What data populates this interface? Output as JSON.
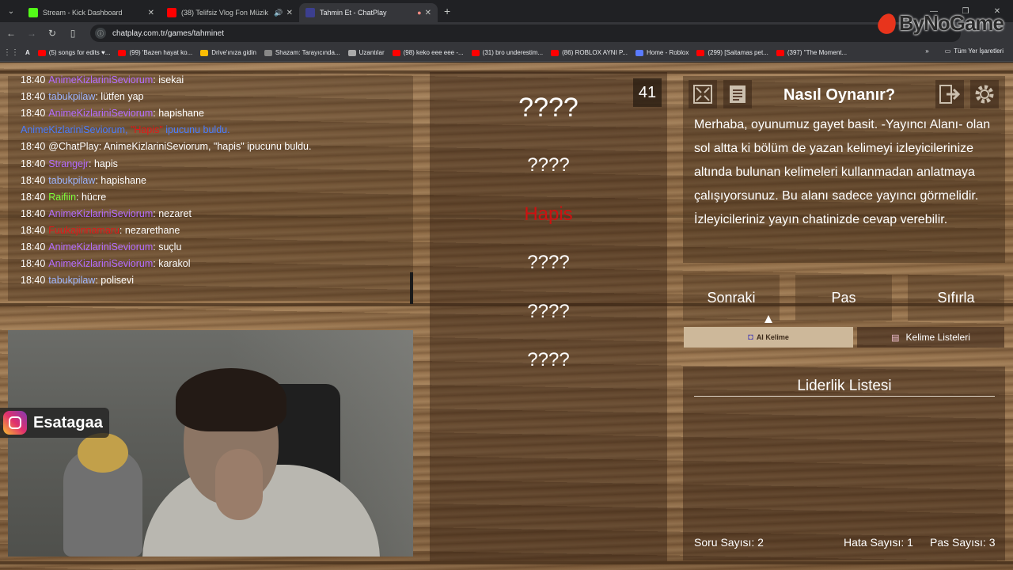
{
  "browser": {
    "tabs": [
      {
        "title": "Stream - Kick Dashboard",
        "color": "#53fc18"
      },
      {
        "title": "(38) Telifsiz Vlog Fon Müzik",
        "color": "#ff0000"
      },
      {
        "title": "Tahmin Et - ChatPlay",
        "color": "#3c3f8f",
        "active": true
      }
    ],
    "url": "chatplay.com.tr/games/tahminet",
    "bookmarks": [
      {
        "label": "(5) songs for edits ♥...",
        "color": "#ff0000"
      },
      {
        "label": "(99) 'Bazen hayat ko...",
        "color": "#ff0000"
      },
      {
        "label": "Drive'ınıza gidin",
        "color": "#fbbc04"
      },
      {
        "label": "Shazam: Tarayıcında...",
        "color": "#888888"
      },
      {
        "label": "Uzantılar",
        "color": "#aaaaaa"
      },
      {
        "label": "(98) keko eee eee -...",
        "color": "#ff0000"
      },
      {
        "label": "(31) bro underestim...",
        "color": "#ff0000"
      },
      {
        "label": "(86) ROBLOX AYNI P...",
        "color": "#ff0000"
      },
      {
        "label": "Home - Roblox",
        "color": "#5a7bff"
      },
      {
        "label": "(299) [Saitamas pet...",
        "color": "#ff0000"
      },
      {
        "label": "(397) \"The Moment...",
        "color": "#ff0000"
      }
    ],
    "bookmarks_right": "Tüm Yer İşaretleri",
    "watermark": "ByNoGame"
  },
  "chat": [
    {
      "time": "18:40",
      "user": "AnimeKizlariniSeviorum",
      "user_color": "#b36cff",
      "text": ": isekai"
    },
    {
      "time": "18:40",
      "user": "tabukpilaw",
      "user_color": "#9db6ff",
      "text": ": lütfen yap"
    },
    {
      "time": "18:40",
      "user": "AnimeKizlariniSeviorum",
      "user_color": "#b36cff",
      "text": ": hapishane"
    },
    {
      "time": "",
      "user": "AnimeKizlariniSeviorum,",
      "user_color": "#4a7dff",
      "highlight": "\"Hapis\"",
      "highlight_color": "#e01818",
      "text": " ipucunu buldu.",
      "text_color": "#4a7dff"
    },
    {
      "time": "18:40",
      "user": "@ChatPlay",
      "user_color": "#ffffff",
      "text": ": AnimeKizlariniSeviorum, \"hapis\" ipucunu buldu."
    },
    {
      "time": "18:40",
      "user": "Strangejr",
      "user_color": "#b36cff",
      "text": ": hapis"
    },
    {
      "time": "18:40",
      "user": "tabukpilaw",
      "user_color": "#9db6ff",
      "text": ": hapishane"
    },
    {
      "time": "18:40",
      "user": "Raifiin",
      "user_color": "#7bff3a",
      "text": ": hücre"
    },
    {
      "time": "18:40",
      "user": "AnimeKizlariniSeviorum",
      "user_color": "#b36cff",
      "text": ": nezaret"
    },
    {
      "time": "18:40",
      "user": "Fuukajinnamaru",
      "user_color": "#e01818",
      "text": ": nezarethane"
    },
    {
      "time": "18:40",
      "user": "AnimeKizlariniSeviorum",
      "user_color": "#b36cff",
      "text": ": suçlu"
    },
    {
      "time": "18:40",
      "user": "AnimeKizlariniSeviorum",
      "user_color": "#b36cff",
      "text": ": karakol"
    },
    {
      "time": "18:40",
      "user": "tabukpilaw",
      "user_color": "#9db6ff",
      "text": ": polisevi"
    }
  ],
  "instagram": "Esatagaa",
  "game": {
    "counter": "41",
    "words": [
      {
        "text": "????",
        "size": 34,
        "color": "#ffffff"
      },
      {
        "text": "????",
        "size": 24,
        "color": "#ffffff"
      },
      {
        "text": "Hapis",
        "size": 24,
        "color": "#d01010"
      },
      {
        "text": "????",
        "size": 24,
        "color": "#ffffff"
      },
      {
        "text": "????",
        "size": 24,
        "color": "#ffffff"
      },
      {
        "text": "????",
        "size": 24,
        "color": "#ffffff"
      }
    ]
  },
  "help": {
    "title": "Nasıl Oynanır?",
    "text": "Merhaba, oyunumuz gayet basit. -Yayıncı Alanı- olan sol altta ki bölüm de yazan kelimeyi izleyicilerinize altında bulunan kelimeleri kullanmadan anlatmaya çalışıyorsunuz. Bu alanı sadece yayıncı görmelidir. İzleyicileriniz yayın chatinizde cevap verebilir."
  },
  "buttons": {
    "next": "Sonraki",
    "pass": "Pas",
    "reset": "Sıfırla",
    "ai_word": "AI Kelime",
    "word_lists": "Kelime Listeleri"
  },
  "leaderboard": {
    "title": "Liderlik Listesi",
    "question_count_label": "Soru Sayısı: 2",
    "error_count_label": "Hata Sayısı: 1",
    "pass_count_label": "Pas Sayısı: 3"
  }
}
